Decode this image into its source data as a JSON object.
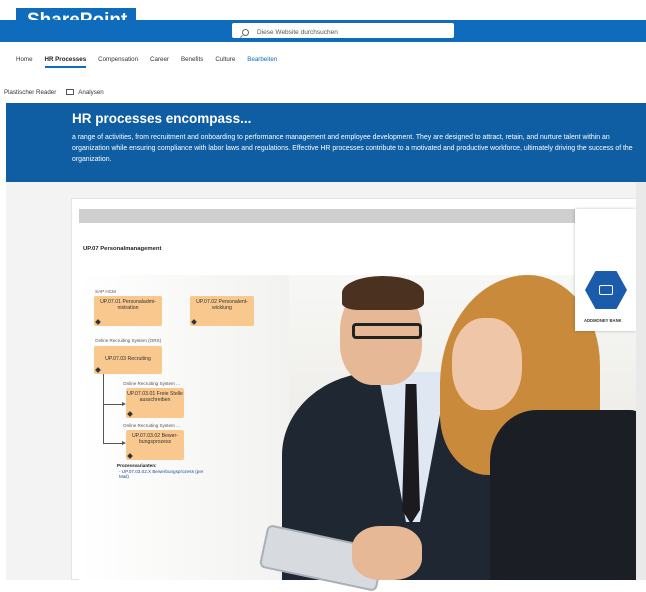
{
  "brand": {
    "title": "SharePoint"
  },
  "search": {
    "placeholder": "Diese Website durchsuchen"
  },
  "nav": {
    "items": [
      "Home",
      "HR Processes",
      "Compensation",
      "Career",
      "Benefits",
      "Culture"
    ],
    "active": "HR Processes",
    "edit": "Bearbeiten"
  },
  "commands": {
    "reader": "Plastischer Reader",
    "analytics": "Analysen"
  },
  "hero": {
    "title": "HR processes encompass...",
    "body": "a range of activities, from recruitment and onboarding to performance management and employee development. They are designed to attract, retain, and nurture talent within an organization while ensuring compliance with labor laws and regulations. Effective HR processes contribute to a motivated and productive workforce, ultimately driving the success of the organization."
  },
  "diagram": {
    "title": "UP.07 Personalmanagement",
    "group_sap": "SAP HCM",
    "node_1": "UP.07.01 Personaladmi-nistration",
    "node_2": "UP.07.02 Personalent-wicklung",
    "group_ors": "Online Recruiting System (ORS)",
    "node_3": "UP.07.03 Recruiting",
    "sub_label_1": "Online Recruiting System ...",
    "node_4": "UP.07.03.01 Freie Stelle ausschreiben",
    "sub_label_2": "Online Recruiting System ...",
    "node_5": "UP.07.03.02 Bewer-bungsprozess",
    "variants_title": "Prozessvarianten:",
    "variant_1": "- UP.07.03.02.X Bewerbungsprozess (per Mail)"
  },
  "bank": {
    "name": "ADDMONEY BANK",
    "icon": "bank-card-icon"
  },
  "colors": {
    "brand_blue": "#0f6cbd",
    "hero_blue": "#0f5da3",
    "node_orange": "#f8c88e",
    "bank_blue": "#1a5cab"
  }
}
